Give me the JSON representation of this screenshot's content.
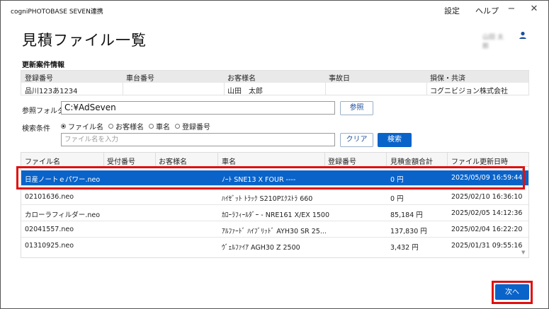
{
  "window": {
    "title": "cogniPHOTOBASE SEVEN連携",
    "menu": {
      "settings": "設定",
      "help": "ヘルプ"
    },
    "minimize": "−",
    "close": "✕"
  },
  "page": {
    "title": "見積ファイル一覧"
  },
  "user": {
    "name": "山田 太郎"
  },
  "case_info": {
    "label": "更新案件情報",
    "headers": [
      "登録番号",
      "車台番号",
      "お客様名",
      "事故日",
      "損保・共済"
    ],
    "values": [
      "品川123あ1234",
      "",
      "山田　太郎",
      "",
      "コグニビジョン株式会社"
    ]
  },
  "folder": {
    "label": "参照フォルダ",
    "value": "C:¥AdSeven",
    "browse_label": "参照"
  },
  "search": {
    "label": "検索条件",
    "options": [
      "ファイル名",
      "お客様名",
      "車名",
      "登録番号"
    ],
    "selected": "ファイル名",
    "placeholder": "ファイル名を入力",
    "clear_label": "クリア",
    "search_label": "検索"
  },
  "table": {
    "columns": [
      "ファイル名",
      "受付番号",
      "お客様名",
      "車名",
      "登録番号",
      "見積金額合計",
      "ファイル更新日時"
    ],
    "rows": [
      [
        "日産ノートｅパワー.neo",
        "",
        "",
        "ﾉｰﾄ SNE13 X FOUR ----",
        "",
        "0 円",
        "2025/05/09 16:59:44"
      ],
      [
        "02101636.neo",
        "",
        "",
        "ﾊｲｾﾞｯﾄ ﾄﾗｯｸ S210Pｴｸｽﾄﾗ 660",
        "",
        "0 円",
        "2025/02/10 16:36:10"
      ],
      [
        "カローラフィルダー.neo",
        "",
        "",
        "ｶﾛｰﾗﾌｨｰﾙﾀﾞｰ - NRE161 X/EX 1500",
        "",
        "85,184 円",
        "2025/02/05 14:12:36"
      ],
      [
        "02041557.neo",
        "",
        "",
        "ｱﾙﾌｧｰﾄﾞ ﾊｲﾌﾞﾘｯﾄﾞ AYH30 SR 25...",
        "",
        "137,830 円",
        "2025/02/04 16:22:20"
      ],
      [
        "01310925.neo",
        "",
        "",
        "ｳﾞｪﾙﾌｧｲｱ AGH30 Z 2500",
        "",
        "3,432 円",
        "2025/01/31 09:55:16"
      ]
    ],
    "selected_row": 0
  },
  "footer": {
    "next_label": "次へ"
  },
  "colors": {
    "accent": "#0a63c9",
    "highlight": "#e01010"
  }
}
